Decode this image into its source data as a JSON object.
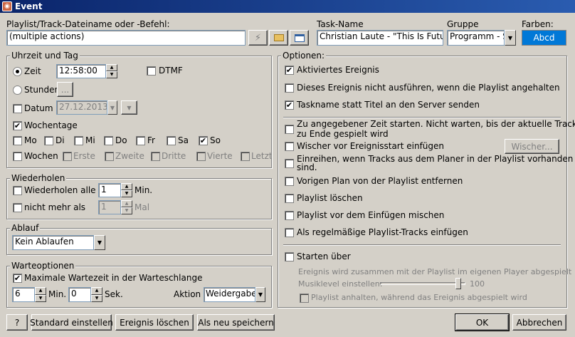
{
  "window": {
    "title": "Event"
  },
  "header": {
    "file_label": "Playlist/Track-Dateiname oder -Befehl:",
    "file_value": "(multiple actions)",
    "taskname_label": "Task-Name",
    "taskname_value": "Christian Laute - \"This Is Future",
    "group_label": "Gruppe",
    "group_value": "Programm - Sc",
    "colors_label": "Farben:",
    "colors_sample": "Abcd",
    "colors_sample_bg": "#0078d7"
  },
  "time": {
    "title": "Uhrzeit und Tag",
    "zeit_label": "Zeit",
    "zeit_value": "12:58:00",
    "dtmf_label": "DTMF",
    "stunden_label": "Stunden",
    "stunden_button": "...",
    "datum_label": "Datum",
    "datum_value": "27.12.2013",
    "wochentage_label": "Wochentage",
    "days": [
      "Mo",
      "Di",
      "Mi",
      "Do",
      "Fr",
      "Sa",
      "So"
    ],
    "wochen_label": "Wochen",
    "weeks": [
      "Erste",
      "Zweite",
      "Dritte",
      "Vierte",
      "Letzte"
    ]
  },
  "repeat": {
    "title": "Wiederholen",
    "repeat_every_label": "Wiederholen alle",
    "repeat_every_value": "1",
    "repeat_every_unit": "Min.",
    "not_more_label": "nicht mehr als",
    "not_more_value": "1",
    "not_more_unit": "Mal"
  },
  "expire": {
    "title": "Ablauf",
    "value": "Kein Ablaufen"
  },
  "wait": {
    "title": "Warteoptionen",
    "max_wait_label": "Maximale Wartezeit in der Warteschlange",
    "min_value": "6",
    "min_unit": "Min.",
    "sec_value": "0",
    "sec_unit": "Sek.",
    "action_label": "Aktion",
    "action_value": "Weidergabe"
  },
  "options": {
    "title": "Optionen:",
    "activated": "Aktiviertes Ereignis",
    "not_execute": "Dieses Ereignis nicht ausführen, wenn die Playlist angehalten wurde",
    "send_taskname": "Taskname statt Titel an den Server senden",
    "start_at_time_line1": "Zu angegebener Zeit starten. Nicht warten, bis der aktuelle Track",
    "start_at_time_line2": "zu Ende gespielt wird",
    "wiper_insert": "Wischer vor Ereignisstart einfügen",
    "wiper_button": "Wischer...",
    "insert_line1": "Einreihen, wenn Tracks aus dem Planer in der Playlist vorhanden",
    "insert_line2": "sind.",
    "remove_prev": "Vorigen Plan von der Playlist entfernen",
    "delete_playlist": "Playlist löschen",
    "shuffle": "Playlist vor dem Einfügen mischen",
    "regular_tracks": "Als regelmäßige Playlist-Tracks einfügen",
    "start_via": "Starten über",
    "player_note": "Ereignis wird zusammen mit der Playlist im eigenen Player abgespielt",
    "music_level_label": "Musiklevel einstellen:",
    "music_level_value": "100",
    "music_level_fraction": 0.95,
    "pause_playlist": "Playlist anhalten, während das Ereignis abgespielt wird"
  },
  "footer": {
    "help": "?",
    "set_default": "Standard einstellen",
    "delete_event": "Ereignis löschen",
    "save_new": "Als neu speichern",
    "ok": "OK",
    "cancel": "Abbrechen"
  }
}
